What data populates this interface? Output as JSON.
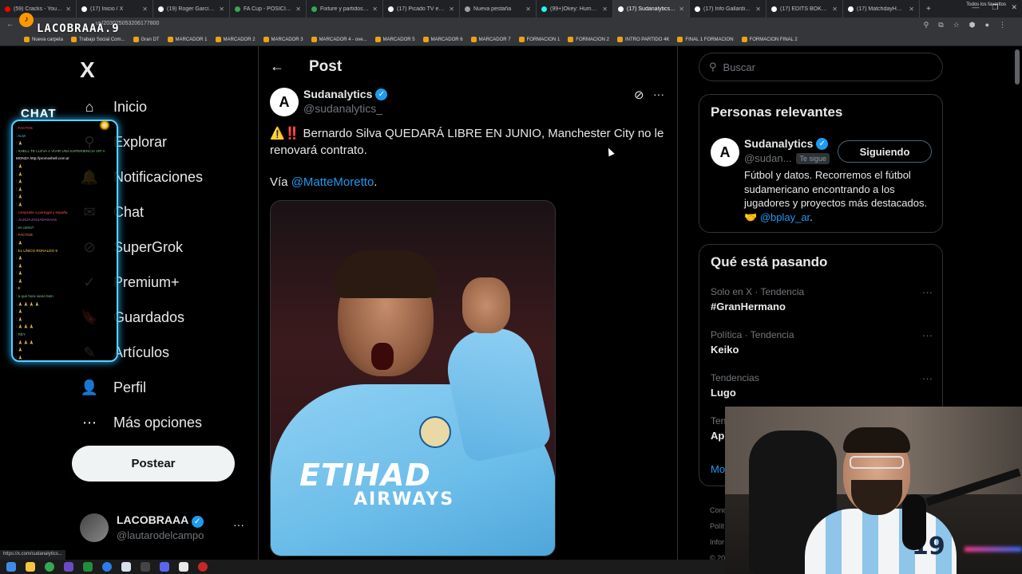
{
  "browser": {
    "tabs": [
      {
        "label": "(59) Cracks - YouTube",
        "color": "#ff0000"
      },
      {
        "label": "(17) Inicio / X",
        "color": "#ffffff"
      },
      {
        "label": "(19) Roger García en X",
        "color": "#ffffff"
      },
      {
        "label": "FA Cup - POSICIONES",
        "color": "#34a853"
      },
      {
        "label": "Fixture y partidos de l",
        "color": "#34a853"
      },
      {
        "label": "(17) Picado TV en X: ‼",
        "color": "#ffffff"
      },
      {
        "label": "Nueva pestaña",
        "color": "#9aa0a6"
      },
      {
        "label": "(99+)Okey: Humor y C",
        "color": "#25f4ee"
      },
      {
        "label": "(17) Sudanalytics en X",
        "color": "#ffffff",
        "active": true
      },
      {
        "label": "(17) Info Gallardista en",
        "color": "#ffffff"
      },
      {
        "label": "(17) EDITS BOKE en X",
        "color": "#ffffff"
      },
      {
        "label": "(17) MatchdayHQ en",
        "color": "#ffffff"
      }
    ],
    "url": "us/203025053206177800",
    "bookmarks": [
      "Nueva carpeta",
      "Trabajo Social Com...",
      "Gran DT",
      "MARCADOR 1",
      "MARCADOR 2",
      "MARCADOR 3",
      "MARCADOR 4 - ove...",
      "MARCADOR 5",
      "MARCADOR 6",
      "MARCADOR 7",
      "FORMACION 1",
      "FORMACION 2",
      "INTRO PARTIDO 4K",
      "FINAL 1 FORMACION",
      "FORMACION FINAL 2"
    ],
    "bookmarks_right": "Todos los favoritos",
    "status_url": "https://x.com/sudanalytics..."
  },
  "overlay": {
    "streamer": "LACOBRAAA.9",
    "chat_title": "CHAT",
    "chat": [
      {
        "user": "",
        "text": ": FACTOS",
        "color": "#ff5252"
      },
      {
        "user": "",
        "text": ": ALM",
        "color": "#4fc3f7"
      },
      {
        "user": "",
        "text": ": 🙏",
        "color": "#ffd54f"
      },
      {
        "user": "",
        "text": ": SHELL TE LLEVA A VIVIR UNA EXPERIENCIA VIP A",
        "color": "#81c784"
      },
      {
        "user": "",
        "text": "MONZA http://promoshell.com.ar",
        "color": "#ffffff"
      },
      {
        "user": "",
        "text": ": 🙏",
        "color": "#ba68c8"
      },
      {
        "user": "",
        "text": ": 🙏",
        "color": "#4fc3f7"
      },
      {
        "user": "",
        "text": ": 🙏",
        "color": "#ff8a65"
      },
      {
        "user": "",
        "text": ": 🙏",
        "color": "#ffd54f"
      },
      {
        "user": "",
        "text": ": 🙏",
        "color": "#81c784"
      },
      {
        "user": "",
        "text": ": 🙏",
        "color": "#4fc3f7"
      },
      {
        "user": "",
        "text": ": comprarle a portugal y españa",
        "color": "#ff5252"
      },
      {
        "user": "",
        "text": ": JAJSJAJASJADASAAS",
        "color": "#ba68c8"
      },
      {
        "user": "",
        "text": ": es cierto?",
        "color": "#81c784"
      },
      {
        "user": "",
        "text": ": FACTOS",
        "color": "#ff8a65"
      },
      {
        "user": "",
        "text": ": 🙏",
        "color": "#4fc3f7"
      },
      {
        "user": "",
        "text": ": EL UNICO RONALDO 9",
        "color": "#ffd54f"
      },
      {
        "user": "",
        "text": ": 🙏",
        "color": "#ba68c8"
      },
      {
        "user": "",
        "text": ": 🙏",
        "color": "#81c784"
      },
      {
        "user": "",
        "text": ": 🙏",
        "color": "#ff5252"
      },
      {
        "user": "",
        "text": ": 🙏",
        "color": "#4fc3f7"
      },
      {
        "user": "",
        "text": ": E",
        "color": "#ffd54f"
      },
      {
        "user": "",
        "text": ": a qué hora viene bsm",
        "color": "#81c784"
      },
      {
        "user": "",
        "text": ": 🙏 🙏 🙏 🙏",
        "color": "#ba68c8"
      },
      {
        "user": "",
        "text": ": 🙏",
        "color": "#ff8a65"
      },
      {
        "user": "",
        "text": ": 🙏",
        "color": "#4fc3f7"
      },
      {
        "user": "",
        "text": ": 🙏 🙏 🙏",
        "color": "#ffd54f"
      },
      {
        "user": "",
        "text": ": REY",
        "color": "#81c784"
      },
      {
        "user": "",
        "text": ": 🙏 🙏 🙏",
        "color": "#ff5252"
      },
      {
        "user": "",
        "text": ": 🙏",
        "color": "#ba68c8"
      },
      {
        "user": "",
        "text": ": 🙏",
        "color": "#4fc3f7"
      }
    ]
  },
  "sidebar": {
    "logo": "X",
    "items": [
      {
        "label": "Inicio",
        "icon": "home-icon",
        "glyph": "⌂"
      },
      {
        "label": "Explorar",
        "icon": "search-icon",
        "glyph": "⚲"
      },
      {
        "label": "Notificaciones",
        "icon": "bell-icon",
        "glyph": "🔔"
      },
      {
        "label": "Chat",
        "icon": "mail-icon",
        "glyph": "✉"
      },
      {
        "label": "SuperGrok",
        "icon": "grok-icon",
        "glyph": "⊘"
      },
      {
        "label": "Premium+",
        "icon": "verified-icon",
        "glyph": "✓"
      },
      {
        "label": "Guardados",
        "icon": "bookmark-icon",
        "glyph": "🔖"
      },
      {
        "label": "Artículos",
        "icon": "article-icon",
        "glyph": "✎"
      },
      {
        "label": "Perfil",
        "icon": "profile-icon",
        "glyph": "👤"
      },
      {
        "label": "Más opciones",
        "icon": "more-circle-icon",
        "glyph": "⋯"
      }
    ],
    "post_button": "Postear",
    "account": {
      "name": "LACOBRAAA",
      "handle": "@lautarodelcampo",
      "more": "···"
    }
  },
  "post": {
    "header_title": "Post",
    "author": {
      "name": "Sudanalytics",
      "handle": "@sudanalytics_",
      "avatar_letter": "A"
    },
    "text": "⚠️‼️ Bernardo Silva QUEDARÁ LIBRE EN JUNIO, Manchester City no le renovará contrato.",
    "via_prefix": "Vía ",
    "via_mention": "@MatteMoretto",
    "via_suffix": ".",
    "image": {
      "sponsor_line1": "ETIHAD",
      "sponsor_line2": "AIRWAYS"
    }
  },
  "right": {
    "search_placeholder": "Buscar",
    "relevant": {
      "title": "Personas relevantes",
      "name": "Sudanalytics",
      "handle": "@sudan...",
      "follows_you": "Te sigue",
      "button": "Siguiendo",
      "bio_text": "Fútbol y datos. Recorremos el fútbol sudamericano encontrando a los jugadores y proyectos más destacados. 🤝 ",
      "bio_mention": "@bplay_ar",
      "bio_suffix": "."
    },
    "trending": {
      "title": "Qué está pasando",
      "items": [
        {
          "meta": "Solo en X · Tendencia",
          "name": "#GranHermano"
        },
        {
          "meta": "Política · Tendencia",
          "name": "Keiko"
        },
        {
          "meta": "Tendencias",
          "name": "Lugo"
        },
        {
          "meta": "Ten",
          "name": "Ap"
        }
      ],
      "show_more": "Mo"
    },
    "footer": [
      "Cond",
      "Polít",
      "Infor",
      "© 20"
    ]
  },
  "webcam": {
    "jersey_number": "19"
  }
}
